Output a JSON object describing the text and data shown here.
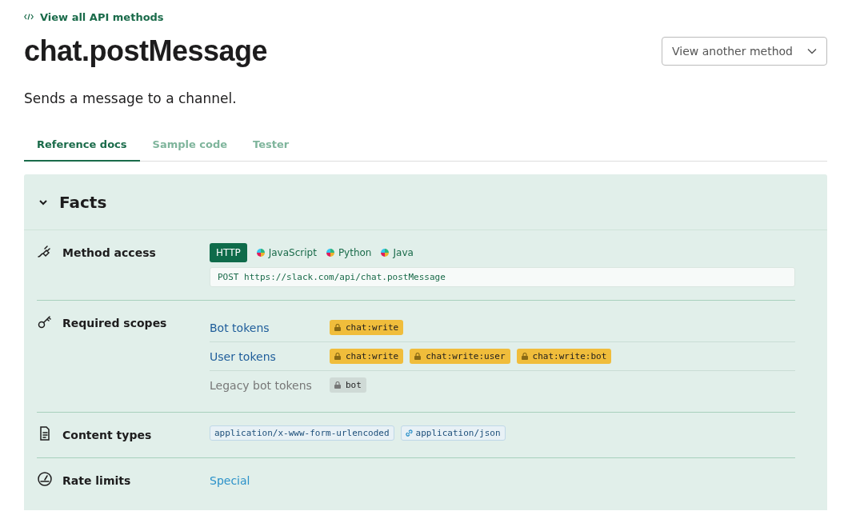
{
  "back_link": {
    "label": "View all API methods"
  },
  "title": "chat.postMessage",
  "method_select": {
    "label": "View another method"
  },
  "summary": "Sends a message to a channel.",
  "tabs": [
    {
      "label": "Reference docs",
      "selected": true
    },
    {
      "label": "Sample code",
      "selected": false
    },
    {
      "label": "Tester",
      "selected": false
    }
  ],
  "facts": {
    "title": "Facts",
    "expanded": true,
    "method_access": {
      "label": "Method access",
      "languages": [
        {
          "label": "HTTP",
          "selected": true
        },
        {
          "label": "JavaScript",
          "selected": false
        },
        {
          "label": "Python",
          "selected": false
        },
        {
          "label": "Java",
          "selected": false
        }
      ],
      "endpoint": "POST https://slack.com/api/chat.postMessage"
    },
    "required_scopes": {
      "label": "Required scopes",
      "token_types": [
        {
          "label": "Bot tokens",
          "kind": "current",
          "scopes": [
            "chat:write"
          ]
        },
        {
          "label": "User tokens",
          "kind": "current",
          "scopes": [
            "chat:write",
            "chat:write:user",
            "chat:write:bot"
          ]
        },
        {
          "label": "Legacy bot tokens",
          "kind": "legacy",
          "scopes": [
            "bot"
          ]
        }
      ]
    },
    "content_types": {
      "label": "Content types",
      "items": [
        {
          "label": "application/x-www-form-urlencoded",
          "kind": "plain"
        },
        {
          "label": "application/json",
          "kind": "link"
        }
      ]
    },
    "rate_limits": {
      "label": "Rate limits",
      "value": "Special"
    }
  }
}
